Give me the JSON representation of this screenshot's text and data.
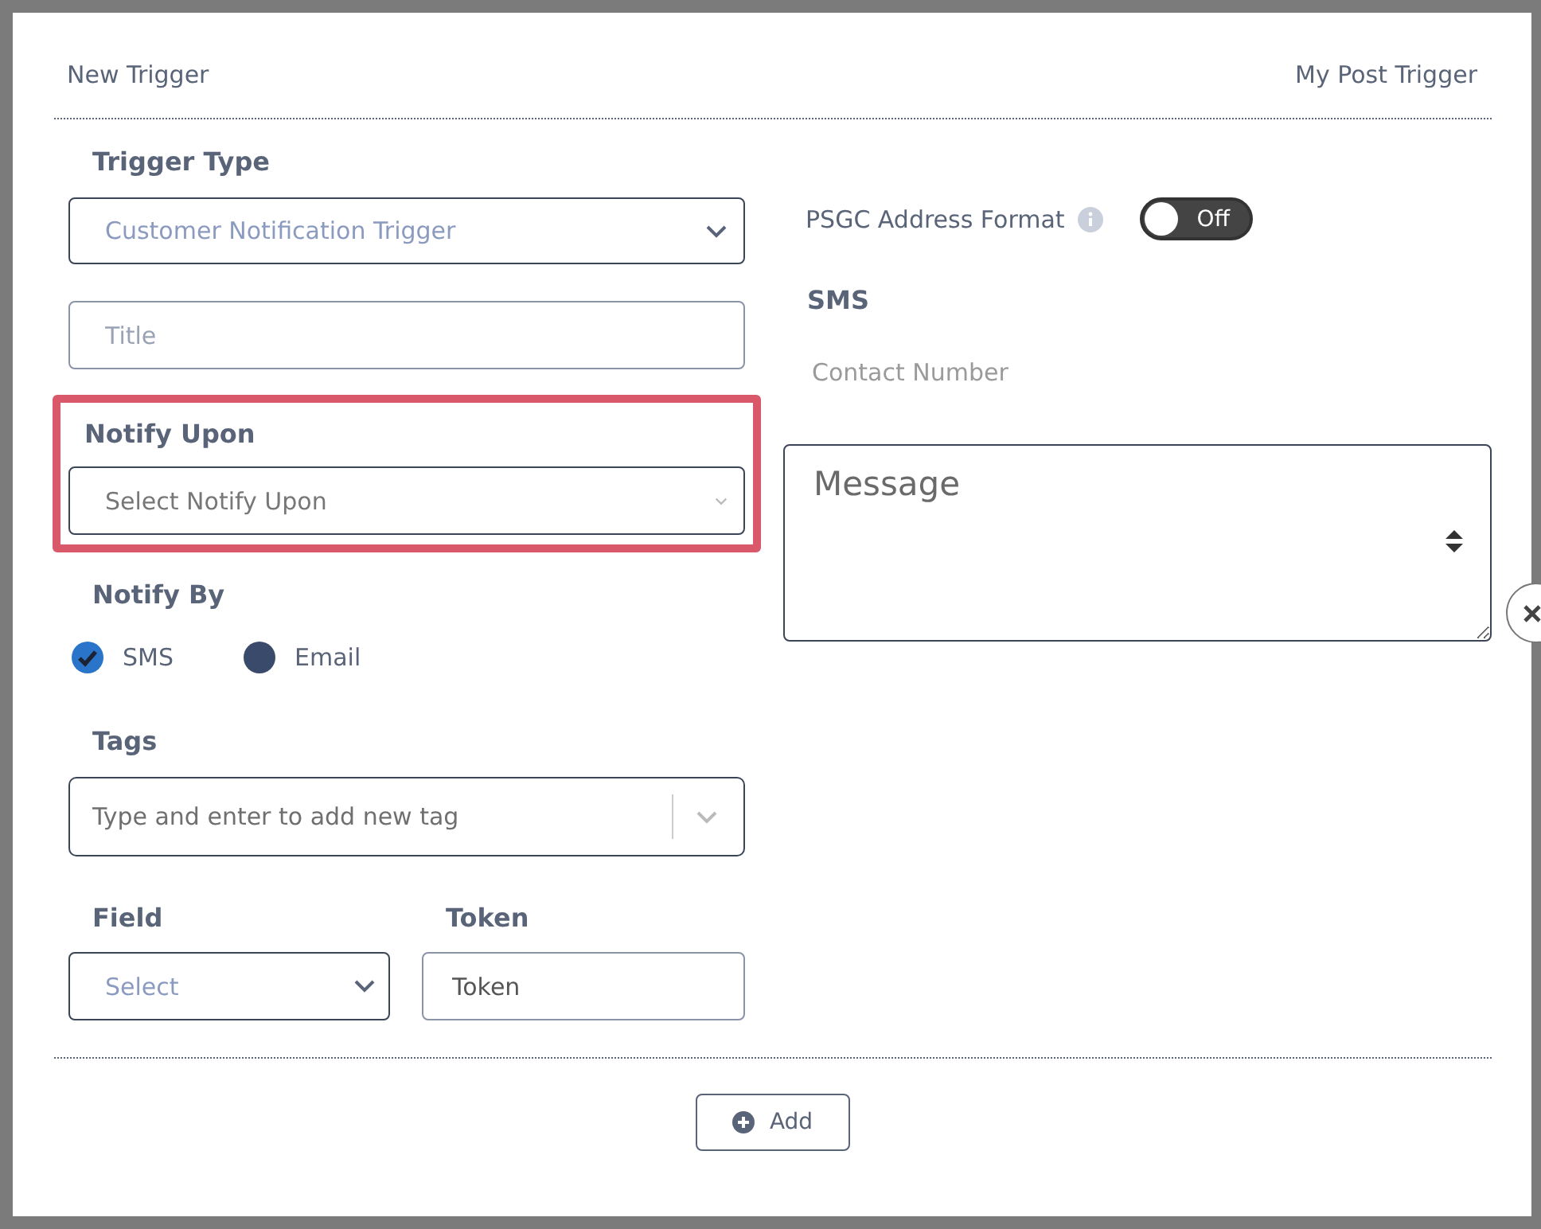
{
  "dialog": {
    "title": "New Trigger",
    "subtitle": "My Post Trigger"
  },
  "trigger_type": {
    "label": "Trigger Type",
    "value": "Customer Notification Trigger"
  },
  "title_field": {
    "placeholder": "Title"
  },
  "notify_upon": {
    "label": "Notify Upon",
    "placeholder": "Select Notify Upon",
    "highlighted": true
  },
  "notify_by": {
    "label": "Notify By",
    "options": [
      {
        "label": "SMS",
        "checked": true
      },
      {
        "label": "Email",
        "checked": false
      }
    ]
  },
  "tags": {
    "label": "Tags",
    "placeholder": "Type and enter to add new tag"
  },
  "field": {
    "label": "Field",
    "placeholder": "Select"
  },
  "token": {
    "label": "Token",
    "value": "Token"
  },
  "psgc": {
    "label": "PSGC Address Format",
    "on": false,
    "toggle_text": "Off"
  },
  "sms": {
    "label": "SMS",
    "contact_placeholder": "Contact Number",
    "message_placeholder": "Message"
  },
  "add_button": {
    "label": "Add"
  }
}
